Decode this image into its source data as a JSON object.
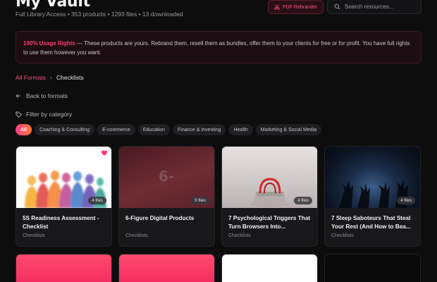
{
  "header": {
    "title": "My Vault",
    "subtitle": "Full Library Access • 353 products • 1293 files • 13 downloaded",
    "pdf_button": "PDF Rebrander",
    "search_placeholder": "Search resources..."
  },
  "notice": {
    "highlight": "100% Usage Rights",
    "text": " — These products are yours. Rebrand them, resell them as bundles, offer them to your clients for free or for profit. You have full rights to use them however you want."
  },
  "breadcrumb": {
    "root": "All Formats",
    "current": "Checklists"
  },
  "back_label": "Back to formats",
  "filter_label": "Filter by category",
  "categories": [
    "All",
    "Coaching & Consulting",
    "E-commerce",
    "Education",
    "Finance & Investing",
    "Health",
    "Marketing & Social Media"
  ],
  "products": [
    {
      "title": "5S Readiness Assessment - Checklist",
      "category": "Checklists",
      "files": "4 files",
      "favorited": true
    },
    {
      "title": "6-Figure Digital Products",
      "category": "Checklists",
      "files": "5 files",
      "thumb_text": "6-"
    },
    {
      "title": "7 Psychological Triggers That Turn Browsers Into...",
      "category": "Checklists",
      "files": "4 files"
    },
    {
      "title": "7 Sleep Saboteurs That Steal Your Rest (And How to Bea...",
      "category": "Checklists",
      "files": "4 files"
    }
  ],
  "colors": {
    "accent": "#ff3d74",
    "background": "#0d0d0e",
    "card": "#18181a"
  }
}
